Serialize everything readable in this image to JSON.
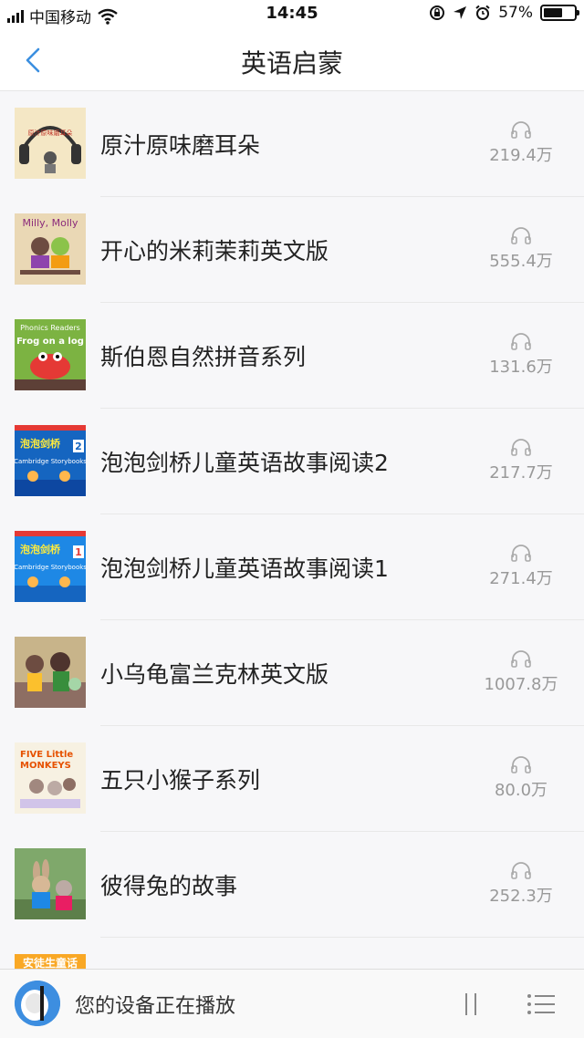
{
  "status_bar": {
    "carrier": "中国移动",
    "time": "14:45",
    "battery": "57%",
    "battery_level": 0.57
  },
  "navbar": {
    "title": "英语启蒙"
  },
  "items": [
    {
      "title": "原汁原味磨耳朵",
      "plays": "219.4万",
      "cover_color": "#f3e6c6"
    },
    {
      "title": "开心的米莉茉莉英文版",
      "plays": "555.4万",
      "cover_color": "#e9d6b3"
    },
    {
      "title": "斯伯恩自然拼音系列",
      "plays": "131.6万",
      "cover_color": "#8bc34a"
    },
    {
      "title": "泡泡剑桥儿童英语故事阅读2",
      "plays": "217.7万",
      "cover_color": "#1976d2"
    },
    {
      "title": "泡泡剑桥儿童英语故事阅读1",
      "plays": "271.4万",
      "cover_color": "#1e88e5"
    },
    {
      "title": "小乌龟富兰克林英文版",
      "plays": "1007.8万",
      "cover_color": "#a1887f"
    },
    {
      "title": "五只小猴子系列",
      "plays": "80.0万",
      "cover_color": "#f5efe0"
    },
    {
      "title": "彼得兔的故事",
      "plays": "252.3万",
      "cover_color": "#7fa86b"
    }
  ],
  "cover_texts": {
    "c0": "原汁原味磨耳朵",
    "c1": "Milly, Molly",
    "c2a": "Phonics Readers",
    "c2b": "Frog on a log",
    "c3": "Cambridge Storybooks",
    "c4": "Cambridge Storybooks",
    "c6a": "FIVE Little",
    "c6b": "MONKEYS",
    "c8": "安徒生童话"
  },
  "player": {
    "text": "您的设备正在播放"
  }
}
